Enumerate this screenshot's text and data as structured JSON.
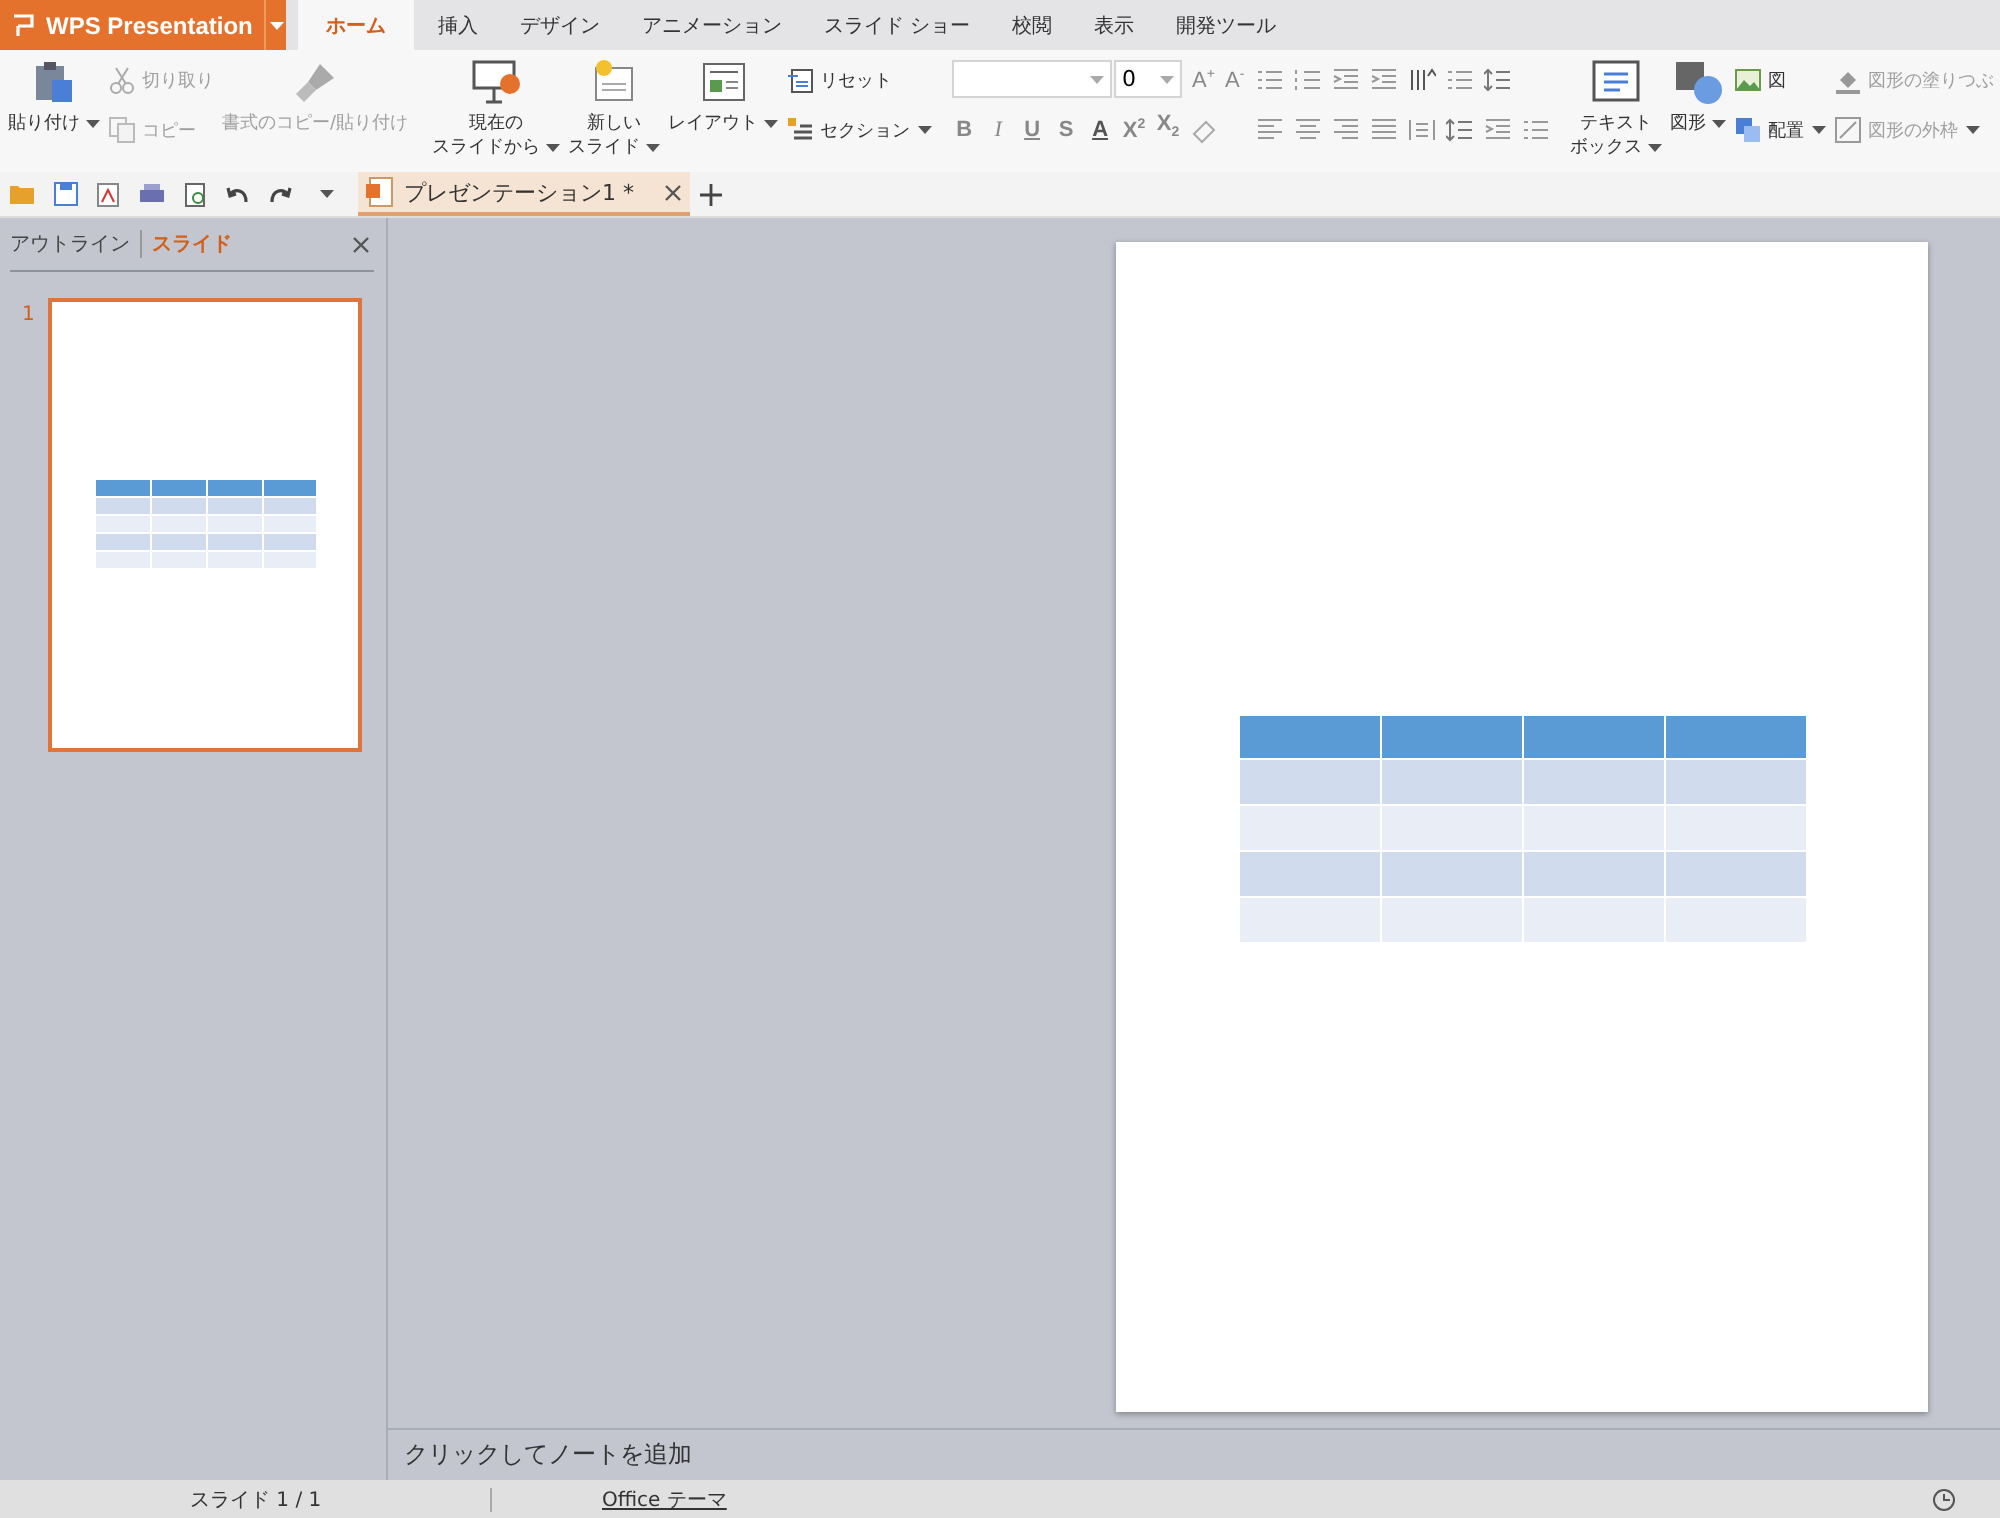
{
  "app_button": {
    "label": "WPS Presentation"
  },
  "tabs": [
    {
      "label": "ホーム",
      "selected": true
    },
    {
      "label": "挿入",
      "selected": false
    },
    {
      "label": "デザイン",
      "selected": false
    },
    {
      "label": "アニメーション",
      "selected": false
    },
    {
      "label": "スライド ショー",
      "selected": false
    },
    {
      "label": "校閲",
      "selected": false
    },
    {
      "label": "表示",
      "selected": false
    },
    {
      "label": "開発ツール",
      "selected": false
    }
  ],
  "ribbon": {
    "groups": [
      {
        "items": [
          {
            "kind": "large",
            "lines": [
              "貼り付け"
            ],
            "menu": true,
            "disabled": false
          },
          {
            "kind": "stack",
            "items": [
              {
                "label": "切り取り",
                "menu": false,
                "disabled": true
              },
              {
                "label": "コピー",
                "menu": false,
                "disabled": true
              }
            ]
          },
          {
            "kind": "large",
            "lines": [
              "書式のコピー/貼り付け"
            ],
            "menu": false,
            "disabled": true
          }
        ]
      },
      {
        "items": [
          {
            "kind": "large",
            "lines": [
              "現在の",
              "スライドから"
            ],
            "menu": true,
            "disabled": false
          },
          {
            "kind": "large",
            "lines": [
              "新しい",
              "スライド"
            ],
            "menu": true,
            "disabled": false
          },
          {
            "kind": "large",
            "lines": [
              "レイアウト"
            ],
            "menu": true,
            "disabled": false
          },
          {
            "kind": "stack",
            "items": [
              {
                "label": "リセット",
                "menu": false,
                "disabled": false
              },
              {
                "label": "セクション",
                "menu": true,
                "disabled": false
              }
            ]
          }
        ]
      },
      {
        "items": [
          {
            "kind": "font",
            "size": "0",
            "grow": [
              "A$^{+}$",
              "A$^{-}$"
            ],
            "styles": [
              "B",
              "I",
              "U",
              "S",
              "A",
              "X$^{2}$",
              "X$_{2}$"
            ]
          },
          {
            "kind": "paragraph"
          }
        ]
      },
      {
        "items": [
          {
            "kind": "large",
            "lines": [
              "テキスト",
              "ボックス"
            ],
            "menu": true,
            "disabled": false
          },
          {
            "kind": "large",
            "lines": [
              "図形"
            ],
            "menu": true,
            "disabled": false
          },
          {
            "kind": "stack",
            "items": [
              {
                "label": "図",
                "menu": false,
                "disabled": false
              },
              {
                "label": "配置",
                "menu": true,
                "disabled": false
              }
            ]
          },
          {
            "kind": "stack",
            "items": [
              {
                "label": "図形の塗りつぶ",
                "menu": false,
                "disabled": true
              },
              {
                "label": "図形の外枠",
                "menu": true,
                "disabled": true
              }
            ]
          }
        ]
      }
    ]
  },
  "document_tab": {
    "title": "プレゼンテーション1 *",
    "selected": true
  },
  "panel": {
    "tabs": [
      {
        "label": "アウトライン",
        "selected": false
      },
      {
        "label": "スライド",
        "selected": true
      }
    ],
    "slides": [
      {
        "number": "1",
        "selected": true
      }
    ]
  },
  "notes": {
    "placeholder": "クリックしてノートを追加"
  },
  "status_bar": {
    "slide": "スライド 1 / 1",
    "theme": "Office テーマ"
  }
}
